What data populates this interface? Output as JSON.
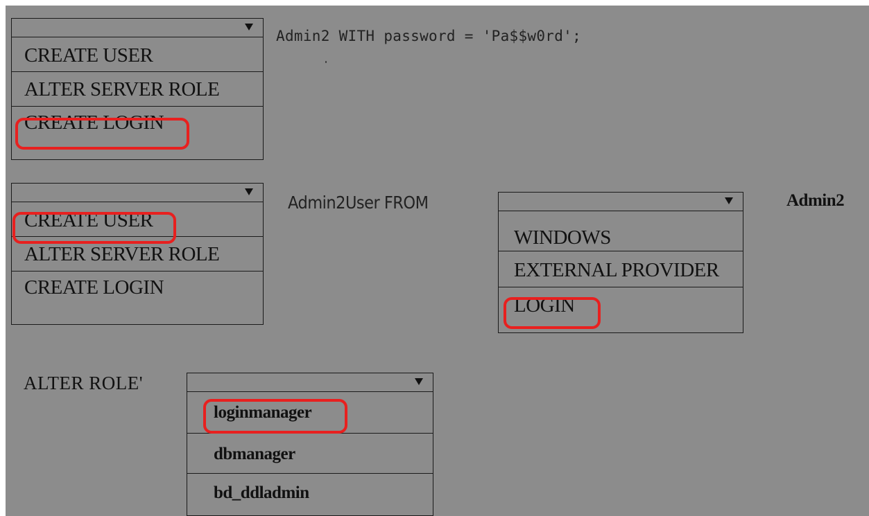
{
  "dropdown1": {
    "options": [
      "CREATE USER",
      "ALTER SERVER ROLE",
      "CREATE LOGIN"
    ],
    "selected": "CREATE LOGIN"
  },
  "line1": {
    "code": "Admin2 WITH password = 'Pa$$w0rd';"
  },
  "dropdown2": {
    "options": [
      "CREATE USER",
      "ALTER SERVER ROLE",
      "CREATE LOGIN"
    ],
    "selected": "CREATE USER"
  },
  "line2": {
    "code": "Admin2User FROM"
  },
  "dropdown3": {
    "options": [
      "WINDOWS",
      "EXTERNAL PROVIDER",
      "LOGIN"
    ],
    "selected": "LOGIN"
  },
  "line2_suffix": {
    "text": "Admin2"
  },
  "line3": {
    "label": "ALTER ROLE'"
  },
  "dropdown4": {
    "options": [
      "loginmanager",
      "dbmanager",
      "bd_ddladmin"
    ],
    "selected": "loginmanager"
  },
  "colors": {
    "background": "#8c8c8c",
    "highlight": "#e8201f",
    "border": "#1a1a1a"
  },
  "icons": {
    "dropdown_arrow": "triangle-down-icon"
  }
}
